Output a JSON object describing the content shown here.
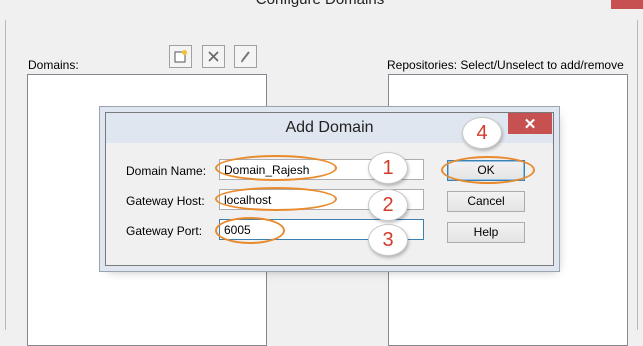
{
  "background": {
    "window_title": "Configure Domains",
    "domains_label": "Domains:",
    "repositories_label": "Repositories: Select/Unselect to add/remove",
    "toolbar": {
      "add_icon": "new-domain-icon",
      "delete_icon": "delete-x-icon",
      "edit_icon": "edit-pencil-icon"
    }
  },
  "dialog": {
    "title": "Add Domain",
    "close_glyph": "✕",
    "fields": [
      {
        "label": "Domain Name:",
        "value": "Domain_Rajesh"
      },
      {
        "label": "Gateway Host:",
        "value": "localhost"
      },
      {
        "label": "Gateway Port:",
        "value": "6005"
      }
    ],
    "buttons": {
      "ok": "OK",
      "cancel": "Cancel",
      "help": "Help"
    }
  },
  "annotations": {
    "step_1": "1",
    "step_2": "2",
    "step_3": "3",
    "step_4": "4",
    "highlight_color": "#e98a2c",
    "number_color": "#d23c2c"
  }
}
